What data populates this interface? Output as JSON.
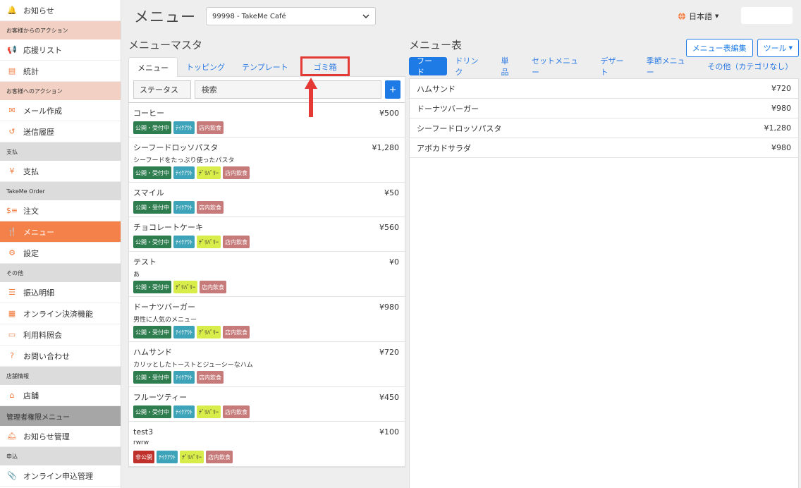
{
  "sidebar": {
    "rows": [
      {
        "kind": "item",
        "icon": "bell-icon",
        "glyph": "🔔",
        "label": "お知らせ"
      },
      {
        "kind": "head",
        "label": "お客様からのアクション"
      },
      {
        "kind": "item",
        "icon": "megaphone-icon",
        "glyph": "📢",
        "label": "応援リスト"
      },
      {
        "kind": "item",
        "icon": "chart-icon",
        "glyph": "▤",
        "label": "統計"
      },
      {
        "kind": "head",
        "label": "お客様へのアクション"
      },
      {
        "kind": "item",
        "icon": "envelope-icon",
        "glyph": "✉",
        "label": "メール作成"
      },
      {
        "kind": "item",
        "icon": "history-icon",
        "glyph": "↺",
        "label": "送信履歴"
      },
      {
        "kind": "headgray",
        "label": "支払"
      },
      {
        "kind": "item",
        "icon": "yen-icon",
        "glyph": "¥",
        "label": "支払"
      },
      {
        "kind": "headgray",
        "label": "TakeMe Order"
      },
      {
        "kind": "item",
        "icon": "order-icon",
        "glyph": "$≡",
        "label": "注文"
      },
      {
        "kind": "item",
        "icon": "utensils-icon",
        "glyph": "🍴",
        "label": "メニュー",
        "active": true
      },
      {
        "kind": "item",
        "icon": "gear-icon",
        "glyph": "⚙",
        "label": "設定"
      },
      {
        "kind": "headgray",
        "label": "その他"
      },
      {
        "kind": "item",
        "icon": "list-icon",
        "glyph": "☰",
        "label": "振込明細"
      },
      {
        "kind": "item",
        "icon": "qr-icon",
        "glyph": "▦",
        "label": "オンライン決済機能"
      },
      {
        "kind": "item",
        "icon": "credit-card-icon",
        "glyph": "▭",
        "label": "利用料照会"
      },
      {
        "kind": "item",
        "icon": "question-icon",
        "glyph": "?",
        "label": "お問い合わせ"
      },
      {
        "kind": "headgray",
        "label": "店舗情報"
      },
      {
        "kind": "item",
        "icon": "store-icon",
        "glyph": "⌂",
        "label": "店舗"
      },
      {
        "kind": "headdark",
        "label": "管理者権限メニュー"
      },
      {
        "kind": "item",
        "icon": "bell-concierge-icon",
        "glyph": "🛎",
        "label": "お知らせ管理"
      },
      {
        "kind": "headgray",
        "label": "申込"
      },
      {
        "kind": "item",
        "icon": "paperclip-icon",
        "glyph": "📎",
        "label": "オンライン申込管理"
      }
    ]
  },
  "header": {
    "title": "メニュー",
    "store": "99998 - TakeMe Café",
    "language": "日本語"
  },
  "left": {
    "title": "メニューマスタ",
    "tabs": [
      "メニュー",
      "トッピング",
      "テンプレート",
      "ゴミ箱"
    ],
    "status_label": "ステータス",
    "search_placeholder": "検索",
    "add_label": "+",
    "items": [
      {
        "name": "コーヒー",
        "price": "¥500",
        "desc": "",
        "tags": [
          "公開・受付中",
          "ﾃｲｸｱｳﾄ",
          "店内飲食"
        ]
      },
      {
        "name": "シーフードロッソパスタ",
        "price": "¥1,280",
        "desc": "シーフードをたっぷり使ったパスタ",
        "tags": [
          "公開・受付中",
          "ﾃｲｸｱｳﾄ",
          "ﾃﾞﾘﾊﾞﾘｰ",
          "店内飲食"
        ]
      },
      {
        "name": "スマイル",
        "price": "¥50",
        "desc": "",
        "tags": [
          "公開・受付中",
          "ﾃｲｸｱｳﾄ",
          "店内飲食"
        ]
      },
      {
        "name": "チョコレートケーキ",
        "price": "¥560",
        "desc": "",
        "tags": [
          "公開・受付中",
          "ﾃｲｸｱｳﾄ",
          "ﾃﾞﾘﾊﾞﾘｰ",
          "店内飲食"
        ]
      },
      {
        "name": "テスト",
        "price": "¥0",
        "desc": "あ",
        "tags": [
          "公開・受付中",
          "ﾃﾞﾘﾊﾞﾘｰ",
          "店内飲食"
        ]
      },
      {
        "name": "ドーナツバーガー",
        "price": "¥980",
        "desc": "男性に人気のメニュー",
        "tags": [
          "公開・受付中",
          "ﾃｲｸｱｳﾄ",
          "ﾃﾞﾘﾊﾞﾘｰ",
          "店内飲食"
        ]
      },
      {
        "name": "ハムサンド",
        "price": "¥720",
        "desc": "カリッとしたトーストとジューシーなハム",
        "tags": [
          "公開・受付中",
          "ﾃｲｸｱｳﾄ",
          "店内飲食"
        ]
      },
      {
        "name": "フルーツティー",
        "price": "¥450",
        "desc": "",
        "tags": [
          "公開・受付中",
          "ﾃｲｸｱｳﾄ",
          "ﾃﾞﾘﾊﾞﾘｰ",
          "店内飲食"
        ]
      },
      {
        "name": "test3",
        "price": "¥100",
        "desc": "rwrw",
        "tags": [
          "非公開",
          "ﾃｲｸｱｳﾄ",
          "ﾃﾞﾘﾊﾞﾘｰ",
          "店内飲食"
        ]
      }
    ]
  },
  "right": {
    "title": "メニュー表",
    "edit_button": "メニュー表編集",
    "tools_button": "ツール",
    "categories": [
      "フード",
      "ドリンク",
      "単品",
      "セットメニュー",
      "デザート",
      "季節メニュー",
      "その他（カテゴリなし）"
    ],
    "items": [
      {
        "name": "ハムサンド",
        "price": "¥720"
      },
      {
        "name": "ドーナツバーガー",
        "price": "¥980"
      },
      {
        "name": "シーフードロッソパスタ",
        "price": "¥1,280"
      },
      {
        "name": "アボカドサラダ",
        "price": "¥980"
      }
    ]
  },
  "colors": {
    "accent": "#f5814a",
    "primary": "#1e7be5",
    "highlight": "#e53935"
  }
}
